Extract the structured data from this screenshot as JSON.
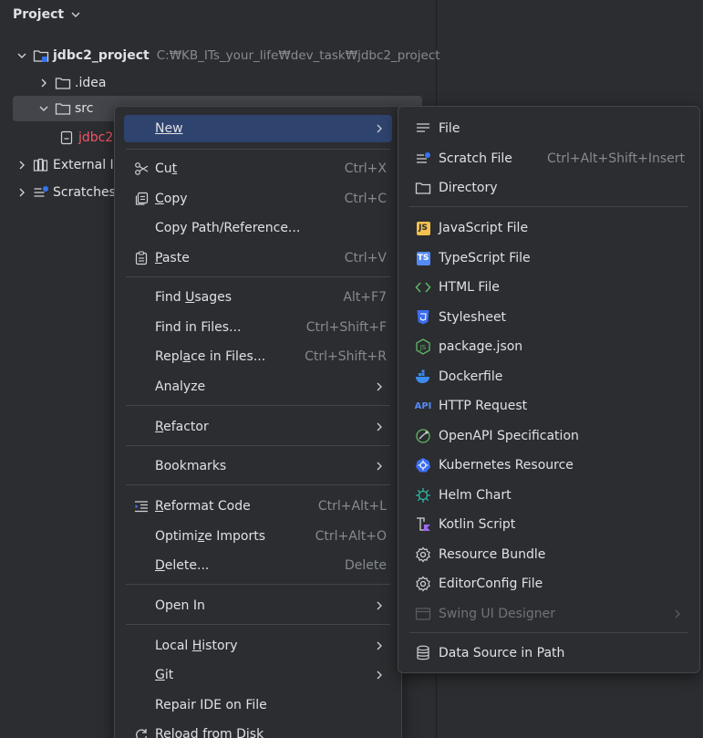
{
  "header": {
    "title": "Project"
  },
  "tree": {
    "root_name": "jdbc2_project",
    "root_path": "C:₩KB_ITs_your_life₩dev_task₩jdbc2_project",
    "idea": ".idea",
    "src": "src",
    "file": "jdbc2",
    "external": "External I",
    "scratches": "Scratches"
  },
  "context_menu": {
    "new": "New",
    "cut": {
      "pre": "Cu",
      "u": "t",
      "post": "",
      "shortcut": "Ctrl+X"
    },
    "copy": {
      "pre": "",
      "u": "C",
      "post": "opy",
      "shortcut": "Ctrl+C"
    },
    "copy_path": "Copy Path/Reference...",
    "paste": {
      "pre": "",
      "u": "P",
      "post": "aste",
      "shortcut": "Ctrl+V"
    },
    "find_usages": {
      "pre": "Find ",
      "u": "U",
      "post": "sages",
      "shortcut": "Alt+F7"
    },
    "find_in_files": {
      "label": "Find in Files...",
      "shortcut": "Ctrl+Shift+F"
    },
    "replace_in_files": {
      "pre": "Repl",
      "u": "a",
      "post": "ce in Files...",
      "shortcut": "Ctrl+Shift+R"
    },
    "analyze": "Analyze",
    "refactor": {
      "pre": "",
      "u": "R",
      "post": "efactor"
    },
    "bookmarks": "Bookmarks",
    "reformat": {
      "pre": "",
      "u": "R",
      "post": "eformat Code",
      "shortcut": "Ctrl+Alt+L"
    },
    "optimize": {
      "pre": "Optimi",
      "u": "z",
      "post": "e Imports",
      "shortcut": "Ctrl+Alt+O"
    },
    "delete": {
      "pre": "",
      "u": "D",
      "post": "elete...",
      "shortcut": "Delete"
    },
    "open_in": "Open In",
    "local_history": {
      "pre": "Local ",
      "u": "H",
      "post": "istory"
    },
    "git": {
      "pre": "",
      "u": "G",
      "post": "it"
    },
    "repair": "Repair IDE on File",
    "reload": "Reload from Disk"
  },
  "new_menu": {
    "file": "File",
    "scratch": {
      "label": "Scratch File",
      "shortcut": "Ctrl+Alt+Shift+Insert"
    },
    "directory": "Directory",
    "javascript": "JavaScript File",
    "typescript": "TypeScript File",
    "html": "HTML File",
    "stylesheet": "Stylesheet",
    "package_json": "package.json",
    "dockerfile": "Dockerfile",
    "http_request": "HTTP Request",
    "openapi": "OpenAPI Specification",
    "kubernetes": "Kubernetes Resource",
    "helm": "Helm Chart",
    "kotlin": "Kotlin Script",
    "resource_bundle": "Resource Bundle",
    "editorconfig": "EditorConfig File",
    "swing": "Swing UI Designer",
    "datasource": "Data Source in Path"
  },
  "icons": {
    "js_badge": "JS",
    "ts_badge": "TS",
    "api_badge": "API"
  },
  "colors": {
    "background": "#2b2d30",
    "selected": "#2e436e",
    "tree_selected": "#43454a",
    "error_red": "#f75464",
    "muted": "#868a91"
  }
}
